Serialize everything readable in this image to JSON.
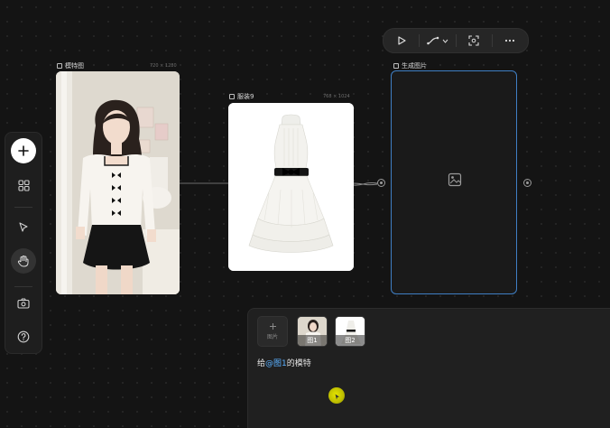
{
  "toolbar": {
    "icons": [
      "play-icon",
      "curve-icon",
      "chevron-down-icon",
      "focus-icon",
      "more-icon"
    ]
  },
  "nodes": {
    "model": {
      "label": "模特图",
      "dims": "720 × 1280"
    },
    "dress": {
      "label": "服装9",
      "dims": "768 × 1024"
    },
    "output": {
      "label": "生成图片"
    }
  },
  "left_toolbar": {
    "items": [
      "add-icon",
      "grid-icon",
      "pointer-icon",
      "hand-icon",
      "camera-icon",
      "help-icon"
    ]
  },
  "prompt": {
    "add_label": "图片",
    "thumb1_label": "图1",
    "thumb2_label": "图2",
    "text_prefix": "给",
    "mention": "@图1",
    "text_suffix": "的模特"
  },
  "colors": {
    "accent": "#5ab0ff",
    "output_border": "#3f7fc4",
    "cursor": "#d4d400"
  }
}
